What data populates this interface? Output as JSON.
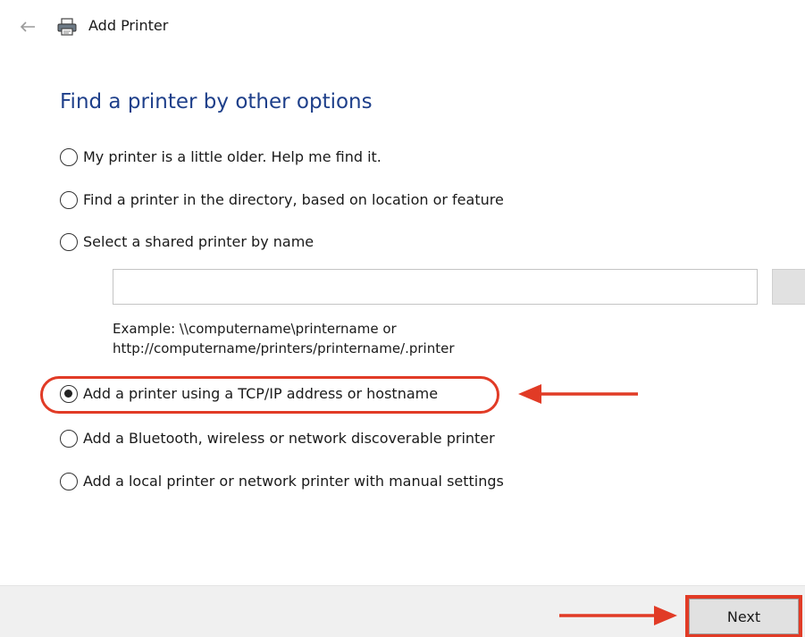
{
  "window": {
    "title": "Add Printer"
  },
  "heading": "Find a printer by other options",
  "options": [
    {
      "label": "My printer is a little older. Help me find it.",
      "checked": false
    },
    {
      "label": "Find a printer in the directory, based on location or feature",
      "checked": false
    },
    {
      "label": "Select a shared printer by name",
      "checked": false
    },
    {
      "label": "Add a printer using a TCP/IP address or hostname",
      "checked": true
    },
    {
      "label": "Add a Bluetooth, wireless or network discoverable printer",
      "checked": false
    },
    {
      "label": "Add a local printer or network printer with manual settings",
      "checked": false
    }
  ],
  "shared_printer": {
    "value": "",
    "example_line1": "Example: \\\\computername\\printername or",
    "example_line2": "http://computername/printers/printername/.printer"
  },
  "footer": {
    "next_label": "Next"
  },
  "annotation": {
    "color": "#e13b26"
  },
  "colors": {
    "heading": "#1e3f8a",
    "footer_bg": "#f0f0f0"
  }
}
